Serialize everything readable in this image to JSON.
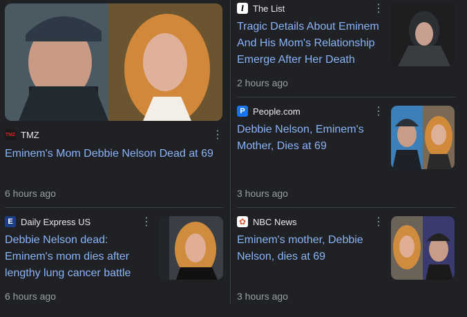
{
  "cards": [
    {
      "source": "TMZ",
      "logo_text": "TMZ",
      "logo_bg": "#1a1a1a",
      "logo_fg": "#e0242b",
      "headline": "Eminem's Mom Debbie Nelson Dead at 69",
      "time": "6 hours ago"
    },
    {
      "source": "The List",
      "logo_text": "l",
      "logo_bg": "#ffffff",
      "logo_fg": "#000000",
      "headline": "Tragic Details About Eminem And His Mom's Relationship Emerge After Her Death",
      "time": "2 hours ago"
    },
    {
      "source": "People.com",
      "logo_text": "P",
      "logo_bg": "#1a73e8",
      "logo_fg": "#ffffff",
      "headline": "Debbie Nelson, Eminem's Mother, Dies at 69",
      "time": "3 hours ago"
    },
    {
      "source": "Daily Express US",
      "logo_text": "E",
      "logo_bg": "#1d3f8a",
      "logo_fg": "#ffffff",
      "headline": "Debbie Nelson dead: Eminem's mom dies after lengthy lung cancer battle",
      "time": "6 hours ago"
    },
    {
      "source": "NBC News",
      "logo_text": "✿",
      "logo_bg": "#ffffff",
      "logo_fg": "#e4572e",
      "headline": "Eminem's mother, Debbie Nelson, dies at 69",
      "time": "3 hours ago"
    }
  ],
  "kebab_glyph": "⋮"
}
